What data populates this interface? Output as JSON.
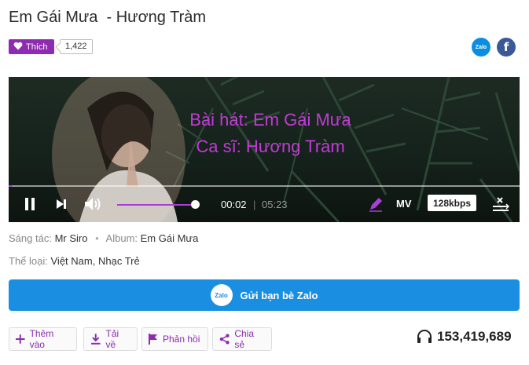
{
  "song": {
    "title": "Em Gái Mưa  - Hương Tràm",
    "like_label": "Thích",
    "like_count": "1,422",
    "lyric_line1": "Bài hát: Em Gái Mưa",
    "lyric_line2": "Ca sĩ: Hương Tràm"
  },
  "social": {
    "zalo_label": "Zalo",
    "facebook_label": "f"
  },
  "player": {
    "current_time": "00:02",
    "separator": "|",
    "duration": "05:23",
    "mv_label": "MV",
    "quality": "128kbps",
    "volume_fraction": 0.95,
    "progress_fraction": 0.006
  },
  "meta": {
    "composer_label": "Sáng tác:",
    "composer": "Mr Siro",
    "album_label": "Album:",
    "album": "Em Gái Mưa",
    "genre_label": "Thể loại:",
    "genre1": "Việt Nam",
    "genre2": "Nhạc Trẻ"
  },
  "share_zalo": {
    "icon_label": "Zalo",
    "label": "Gửi bạn bè Zalo"
  },
  "actions": {
    "add": "Thêm vào",
    "download": "Tải về",
    "report": "Phản hồi",
    "share": "Chia sẻ"
  },
  "listens": "153,419,689",
  "colors": {
    "accent": "#8e2bb0",
    "lyric": "#c23ad6",
    "zalo_blue": "#1a8ee1",
    "facebook": "#3b5998"
  }
}
